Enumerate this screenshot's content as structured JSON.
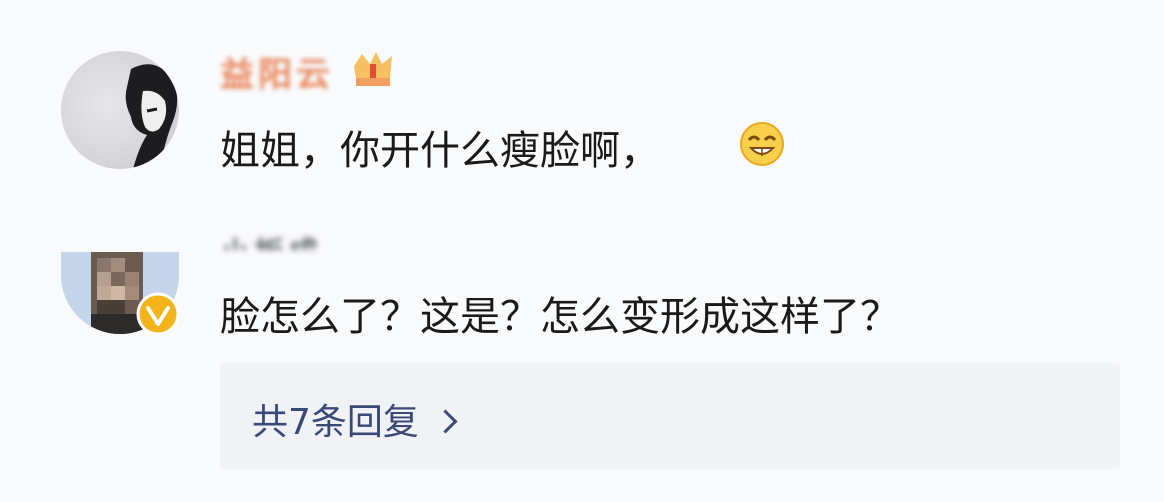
{
  "comments": [
    {
      "username": "益阳云",
      "text": "姐姐，你开什么瘦脸啊，",
      "emoji": "grinning-face-emoji"
    },
    {
      "username": "小板成",
      "text": "脸怎么了？这是？怎么变形成这样了？",
      "verified_badge": "verified-v-icon"
    }
  ],
  "replies": {
    "label": "共7条回复"
  },
  "colors": {
    "background": "#f9fafc",
    "reply_box": "#f1f2f6",
    "link": "#3a4a78",
    "verified": "#f2b31b"
  }
}
